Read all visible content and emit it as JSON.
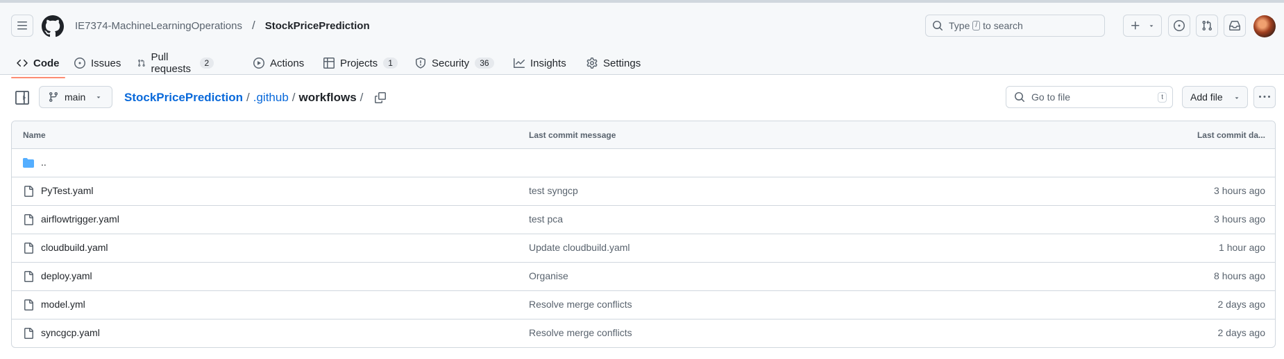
{
  "header": {
    "owner": "IE7374-MachineLearningOperations",
    "separator": "/",
    "repo": "StockPricePrediction",
    "search_pre": "Type",
    "search_key": "/",
    "search_post": "to search"
  },
  "tabs": [
    {
      "label": "Code",
      "icon": "code-icon",
      "counter": null
    },
    {
      "label": "Issues",
      "icon": "issue-icon",
      "counter": null
    },
    {
      "label": "Pull requests",
      "icon": "pull-request-icon",
      "counter": "2"
    },
    {
      "label": "Actions",
      "icon": "play-icon",
      "counter": null
    },
    {
      "label": "Projects",
      "icon": "table-icon",
      "counter": "1"
    },
    {
      "label": "Security",
      "icon": "shield-icon",
      "counter": "36"
    },
    {
      "label": "Insights",
      "icon": "graph-icon",
      "counter": null
    },
    {
      "label": "Settings",
      "icon": "gear-icon",
      "counter": null
    }
  ],
  "toolbar": {
    "branch": "main",
    "crumbs": [
      "StockPricePrediction",
      ".github",
      "workflows"
    ],
    "crumb_sep": "/",
    "goto_placeholder": "Go to file",
    "goto_key": "t",
    "add_file": "Add file"
  },
  "table": {
    "headers": {
      "name": "Name",
      "message": "Last commit message",
      "date": "Last commit da..."
    },
    "parent_dir": "..",
    "rows": [
      {
        "name": "PyTest.yaml",
        "message": "test syngcp",
        "date": "3 hours ago"
      },
      {
        "name": "airflowtrigger.yaml",
        "message": "test pca",
        "date": "3 hours ago"
      },
      {
        "name": "cloudbuild.yaml",
        "message": "Update cloudbuild.yaml",
        "date": "1 hour ago"
      },
      {
        "name": "deploy.yaml",
        "message": "Organise",
        "date": "8 hours ago"
      },
      {
        "name": "model.yml",
        "message": "Resolve merge conflicts",
        "date": "2 days ago"
      },
      {
        "name": "syncgcp.yaml",
        "message": "Resolve merge conflicts",
        "date": "2 days ago"
      }
    ]
  },
  "colors": {
    "link": "#0969da",
    "tab_underline": "#fd8c73",
    "folder": "#54aeff"
  }
}
